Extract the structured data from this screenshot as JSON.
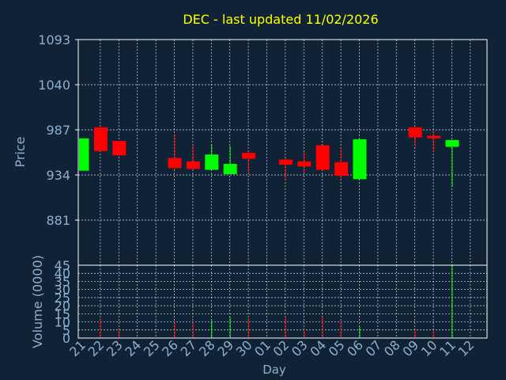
{
  "title": "DEC - last updated 11/02/2026",
  "colors": {
    "background": "#0f2236",
    "title": "#ffff00",
    "axis_text": "#8fb0cf",
    "grid": "#ffffff",
    "up": "#00ff00",
    "down": "#ff0000"
  },
  "chart_data": [
    {
      "type": "candlestick",
      "ylabel": "Price",
      "ylim": [
        828,
        1093
      ],
      "y_ticks": [
        "1093",
        "1040",
        "987",
        "934",
        "881"
      ],
      "grid": true,
      "candles": [
        {
          "day": "21",
          "open": 939,
          "high": 977,
          "low": 939,
          "close": 977
        },
        {
          "day": "22",
          "open": 990,
          "high": 990,
          "low": 962,
          "close": 962
        },
        {
          "day": "23",
          "open": 974,
          "high": 974,
          "low": 956,
          "close": 957
        },
        {
          "day": "26",
          "open": 954,
          "high": 982,
          "low": 940,
          "close": 942
        },
        {
          "day": "27",
          "open": 950,
          "high": 970,
          "low": 940,
          "close": 941
        },
        {
          "day": "28",
          "open": 940,
          "high": 970,
          "low": 940,
          "close": 958
        },
        {
          "day": "29",
          "open": 935,
          "high": 968,
          "low": 935,
          "close": 947
        },
        {
          "day": "30",
          "open": 960,
          "high": 963,
          "low": 937,
          "close": 953
        },
        {
          "day": "02",
          "open": 952,
          "high": 954,
          "low": 927,
          "close": 946
        },
        {
          "day": "03",
          "open": 950,
          "high": 961,
          "low": 937,
          "close": 944
        },
        {
          "day": "04",
          "open": 969,
          "high": 969,
          "low": 940,
          "close": 940
        },
        {
          "day": "05",
          "open": 949,
          "high": 967,
          "low": 928,
          "close": 933
        },
        {
          "day": "06",
          "open": 929,
          "high": 976,
          "low": 929,
          "close": 976
        },
        {
          "day": "09",
          "open": 990,
          "high": 991,
          "low": 967,
          "close": 978
        },
        {
          "day": "10",
          "open": 980,
          "high": 986,
          "low": 962,
          "close": 977
        },
        {
          "day": "11",
          "open": 967,
          "high": 975,
          "low": 920,
          "close": 975
        }
      ]
    },
    {
      "type": "bar",
      "ylabel": "Volume (0000)",
      "ylim": [
        0,
        45
      ],
      "y_ticks": [
        "45",
        "40",
        "35",
        "30",
        "25",
        "20",
        "15",
        "10",
        "5",
        "0"
      ],
      "grid": true,
      "volumes": [
        {
          "day": "22",
          "value": 12,
          "direction": "down"
        },
        {
          "day": "23",
          "value": 6,
          "direction": "down"
        },
        {
          "day": "26",
          "value": 10,
          "direction": "down"
        },
        {
          "day": "27",
          "value": 10,
          "direction": "down"
        },
        {
          "day": "28",
          "value": 11,
          "direction": "up"
        },
        {
          "day": "29",
          "value": 13,
          "direction": "up"
        },
        {
          "day": "30",
          "value": 12,
          "direction": "down"
        },
        {
          "day": "02",
          "value": 13,
          "direction": "down"
        },
        {
          "day": "03",
          "value": 6,
          "direction": "down"
        },
        {
          "day": "04",
          "value": 13,
          "direction": "down"
        },
        {
          "day": "05",
          "value": 11,
          "direction": "down"
        },
        {
          "day": "06",
          "value": 7,
          "direction": "up"
        },
        {
          "day": "09",
          "value": 6,
          "direction": "down"
        },
        {
          "day": "10",
          "value": 5,
          "direction": "down"
        },
        {
          "day": "11",
          "value": 45,
          "direction": "up"
        }
      ]
    }
  ],
  "x_axis": {
    "label": "Day",
    "ticks": [
      "21",
      "22",
      "23",
      "24",
      "25",
      "26",
      "27",
      "28",
      "29",
      "30",
      "01",
      "02",
      "03",
      "04",
      "05",
      "06",
      "07",
      "08",
      "09",
      "10",
      "11",
      "12"
    ]
  }
}
